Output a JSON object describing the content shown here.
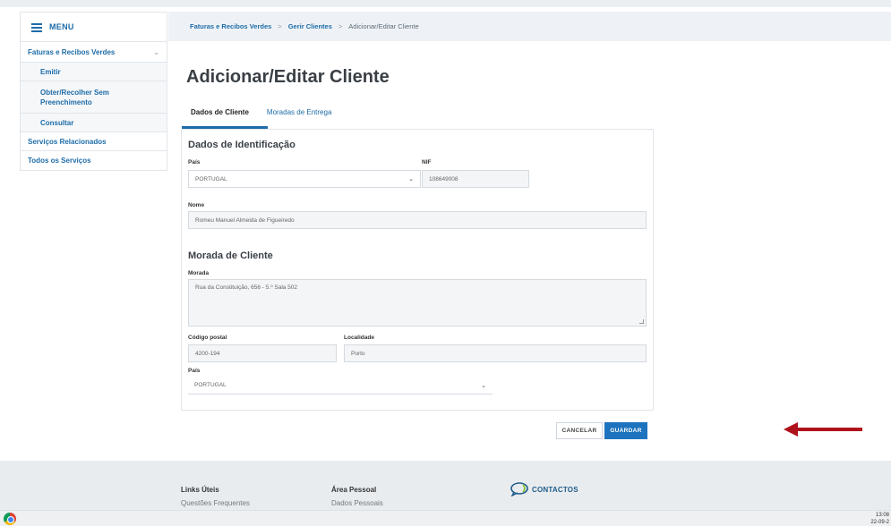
{
  "sidebar": {
    "menu_label": "MENU",
    "section_faturas": "Faturas e Recibos Verdes",
    "sub_items": [
      "Emitir",
      "Obter/Recolher Sem Preenchimento",
      "Consultar"
    ],
    "items": [
      "Serviços Relacionados",
      "Todos os Serviços"
    ]
  },
  "breadcrumb": {
    "items": [
      "Faturas e Recibos Verdes",
      "Gerir Clientes",
      "Adicionar/Editar Cliente"
    ],
    "separator": ">"
  },
  "page": {
    "title": "Adicionar/Editar Cliente"
  },
  "tabs": [
    "Dados de Cliente",
    "Moradas de Entrega"
  ],
  "form": {
    "identificacao_title": "Dados de Identificação",
    "pais_label": "País",
    "pais_value": "PORTUGAL",
    "nif_label": "NIF",
    "nif_value": "108649008",
    "nome_label": "Nome",
    "nome_value": "Romeu Manuel Almeida de Figueiredo",
    "morada_title": "Morada de Cliente",
    "morada_label": "Morada",
    "morada_value": "Rua da Constituição, 656 - 5.º Sala 502",
    "codigo_postal_label": "Código postal",
    "codigo_postal_value": "4200-194",
    "localidade_label": "Localidade",
    "localidade_value": "Porto",
    "pais2_label": "País",
    "pais2_value": "PORTUGAL"
  },
  "buttons": {
    "cancel": "CANCELAR",
    "save": "GUARDAR"
  },
  "footer": {
    "links_uteis": "Links Úteis",
    "links_item": "Questões Frequentes",
    "area_pessoal": "Área Pessoal",
    "area_item": "Dados Pessoais",
    "contacts": "CONTACTOS"
  },
  "taskbar": {
    "time": "13:08",
    "date": "22-09-2"
  },
  "colors": {
    "accent": "#1e6ca8",
    "save_button": "#1e73be",
    "arrow": "#b0121b"
  },
  "icons": {
    "menu": "hamburger-icon",
    "chevron": "chevron-down-icon",
    "browser": "chrome-icon",
    "contacts": "speech-bubble-icon"
  }
}
